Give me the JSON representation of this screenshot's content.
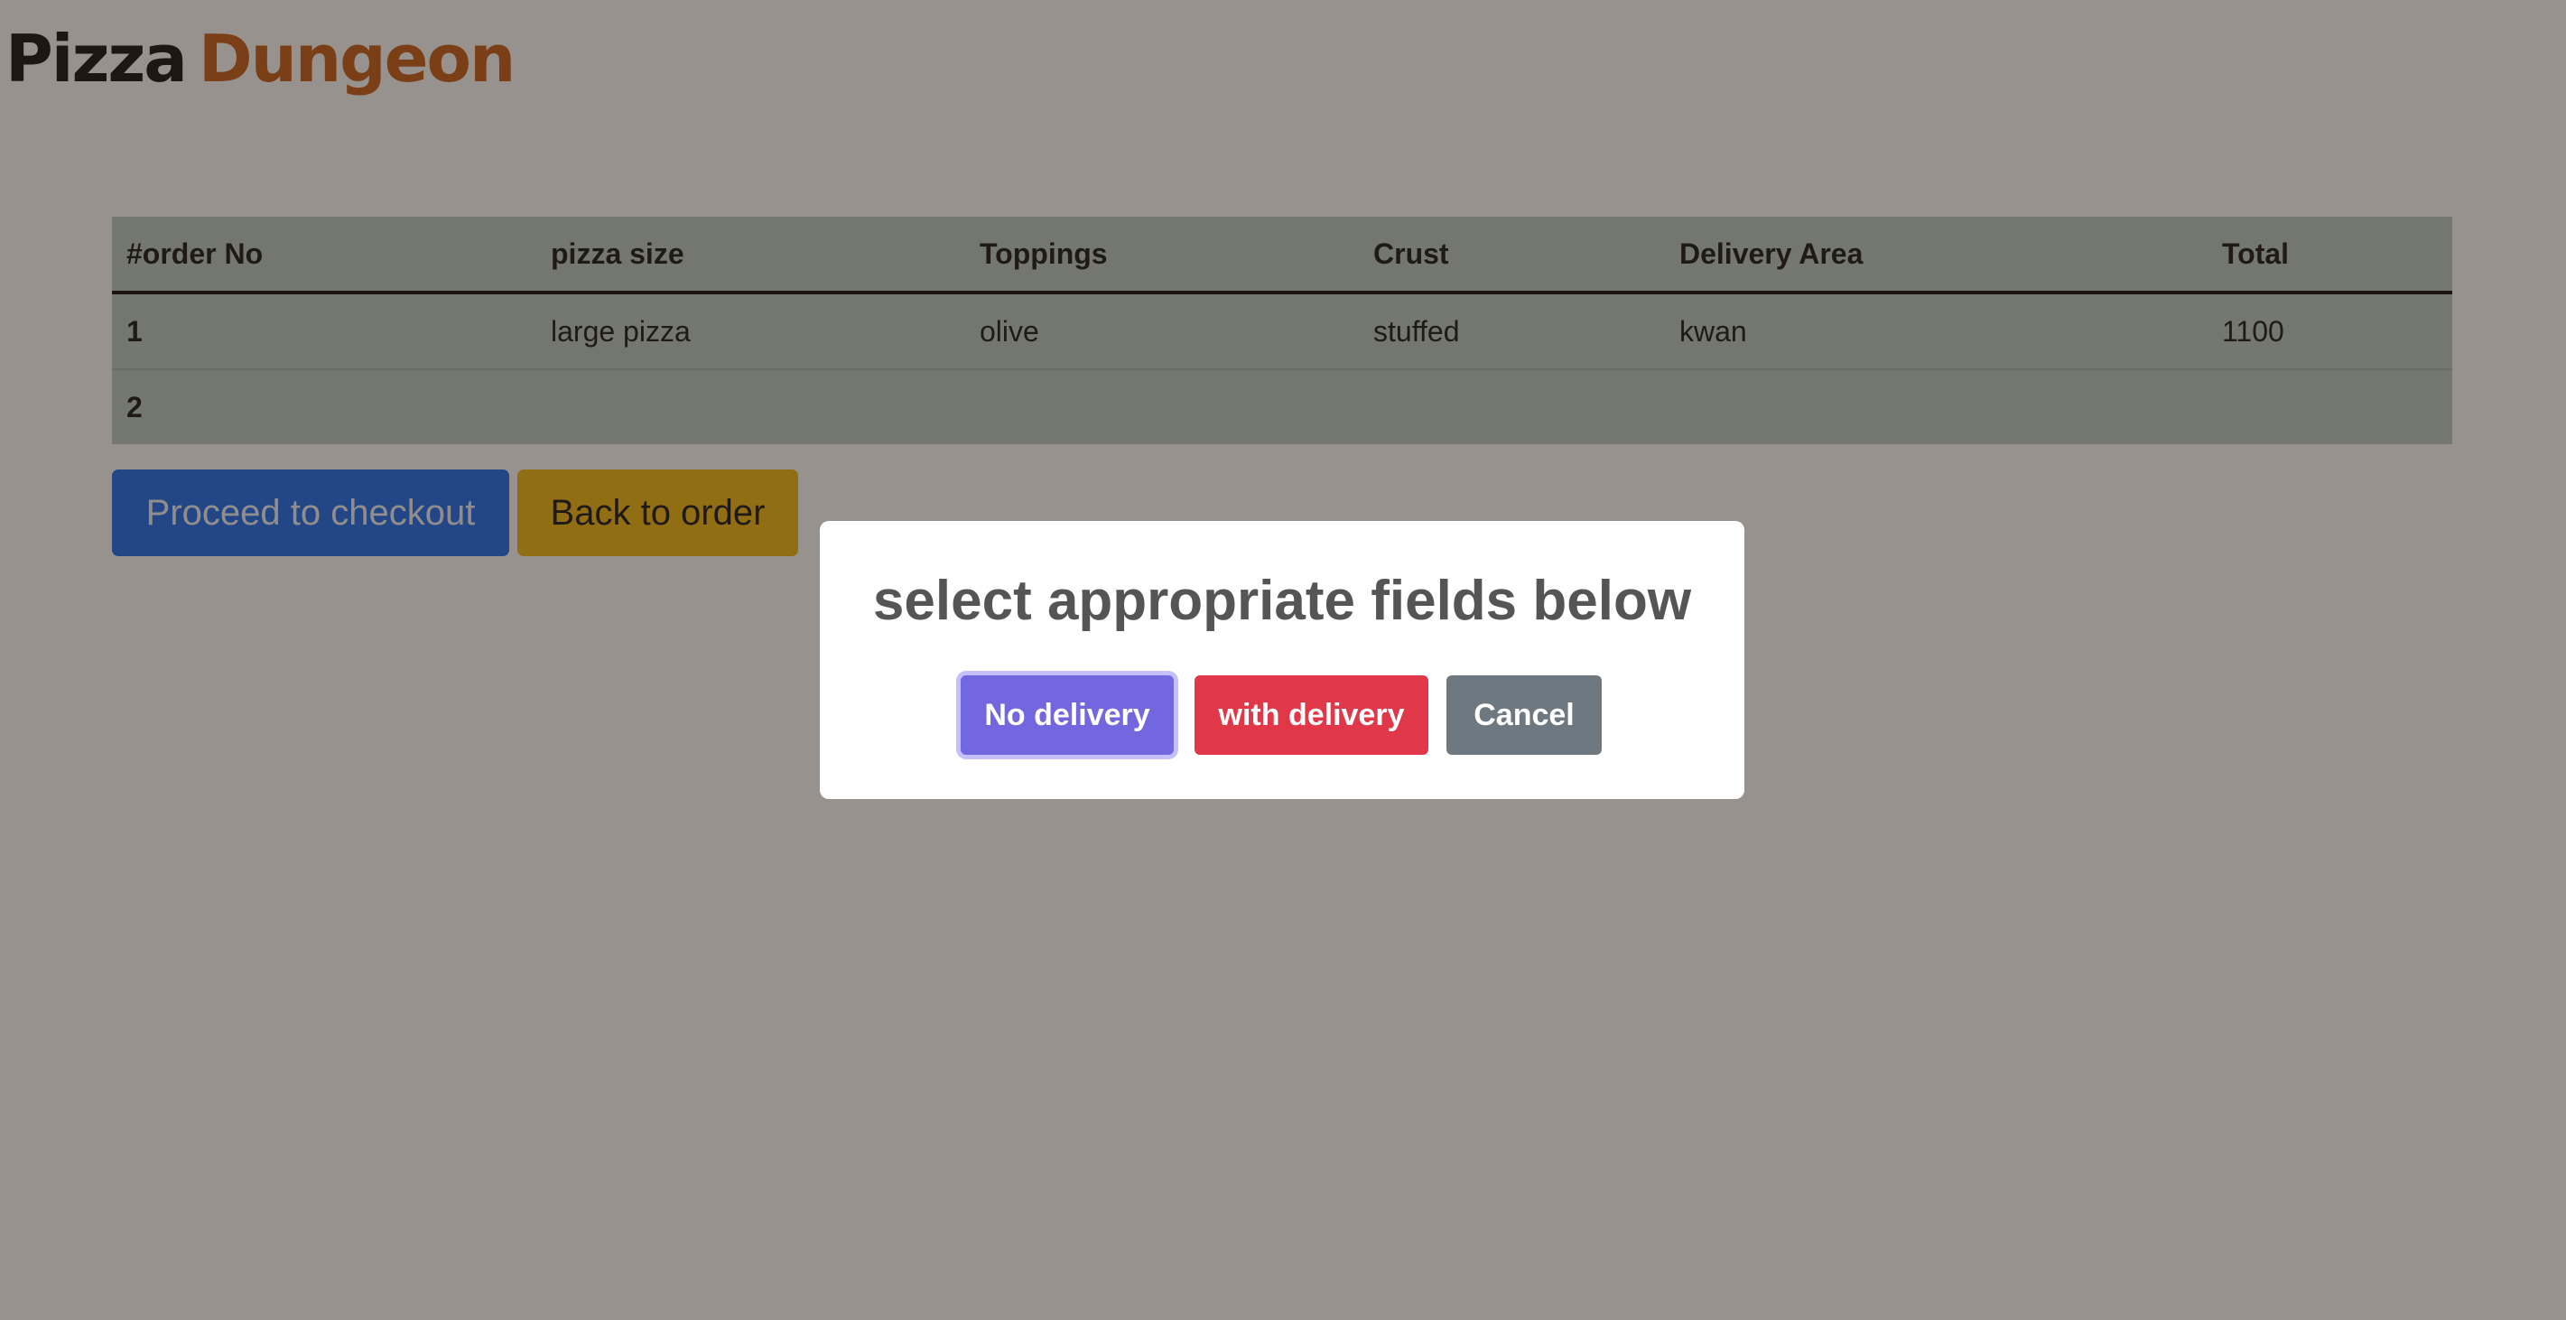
{
  "brand": {
    "word1": "Pizza",
    "word2": "Dungeon"
  },
  "table": {
    "headers": [
      "#order No",
      "pizza size",
      "Toppings",
      "Crust",
      "Delivery Area",
      "Total"
    ],
    "rows": [
      {
        "order_no": "1",
        "pizza_size": "large pizza",
        "toppings": "olive",
        "crust": "stuffed",
        "delivery_area": "kwan",
        "total": "1100"
      },
      {
        "order_no": "2",
        "pizza_size": "",
        "toppings": "",
        "crust": "",
        "delivery_area": "",
        "total": ""
      }
    ]
  },
  "actions": {
    "checkout_label": "Proceed to checkout",
    "back_label": "Back to order"
  },
  "modal": {
    "title": "select appropriate fields below",
    "no_delivery_label": "No delivery",
    "with_delivery_label": "with delivery",
    "cancel_label": "Cancel"
  },
  "colors": {
    "brand_accent": "#c8601c",
    "checkout": "#1f6ff0",
    "back": "#f1b815",
    "no_delivery": "#7367e0",
    "with_delivery": "#e03848",
    "cancel": "#6e7880",
    "table_bg": "#b8cbc1"
  }
}
